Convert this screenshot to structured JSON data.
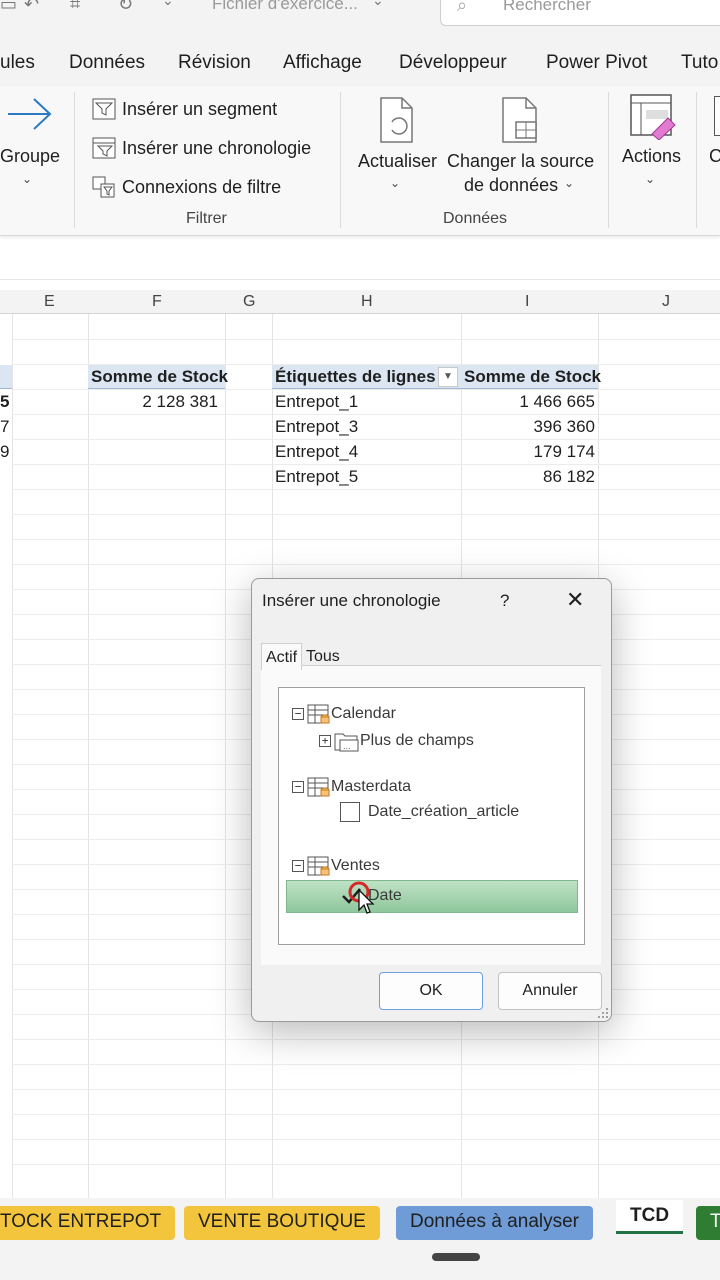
{
  "titlebar": {
    "filename": "Fichier d'exercice...",
    "search_placeholder": "Rechercher"
  },
  "ribbon_tabs": [
    "ules",
    "Données",
    "Révision",
    "Affichage",
    "Développeur",
    "Power Pivot",
    "Tuto"
  ],
  "ribbon": {
    "groupe_label": "Groupe",
    "filter_buttons": [
      "Insérer un segment",
      "Insérer une chronologie",
      "Connexions de filtre"
    ],
    "filter_group_label": "Filtrer",
    "actualiser_label": "Actualiser",
    "changer_source_label_1": "Changer la source",
    "changer_source_label_2": "de données",
    "donnees_group_label": "Données",
    "actions_label": "Actions",
    "cut_label": "C"
  },
  "sheet": {
    "columns": [
      "E",
      "F",
      "G",
      "H",
      "I",
      "J"
    ],
    "left_edge_values": [
      "5",
      "7",
      "9"
    ],
    "f_header": "Somme de Stock",
    "f_value": "2 128 381",
    "h_header": "Étiquettes de lignes",
    "i_header": "Somme de Stock",
    "rows": [
      {
        "label": "Entrepot_1",
        "value": "1 466 665"
      },
      {
        "label": "Entrepot_3",
        "value": "396 360"
      },
      {
        "label": "Entrepot_4",
        "value": "179 174"
      },
      {
        "label": "Entrepot_5",
        "value": "86 182"
      }
    ]
  },
  "dialog": {
    "title": "Insérer une chronologie",
    "help": "?",
    "close": "✕",
    "tab_actif": "Actif",
    "tab_tous": "Tous",
    "tree": {
      "calendar": "Calendar",
      "plus_champs": "Plus de champs",
      "masterdata": "Masterdata",
      "date_creation": "Date_création_article",
      "ventes": "Ventes",
      "date": "Date"
    },
    "ok": "OK",
    "cancel": "Annuler"
  },
  "sheet_tabs": [
    {
      "label": "TOCK ENTREPOT",
      "color": "#f2c53d"
    },
    {
      "label": "VENTE BOUTIQUE",
      "color": "#f2c53d"
    },
    {
      "label": "Données à analyser",
      "color": "#6f9bd6"
    },
    {
      "label": "TCD",
      "color": "#ffffff"
    },
    {
      "label": "T",
      "color": "#2e7d32"
    }
  ],
  "colors": {
    "accent_green": "#217346",
    "pivot_header": "#dce6f2",
    "selection_green": "#a8d5b2"
  }
}
